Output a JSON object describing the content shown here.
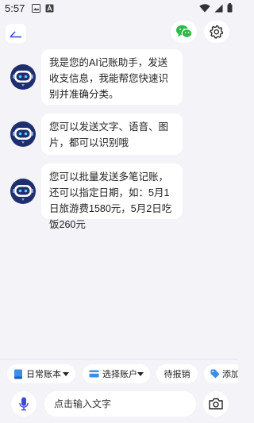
{
  "status": {
    "time": "5:57"
  },
  "messages": [
    {
      "text": "我是您的AI记账助手，发送收支信息，我能帮您快速识别并准确分类。"
    },
    {
      "text": "您可以发送文字、语音、图片，都可以识别哦"
    },
    {
      "text": "您可以批量发送多笔记账，还可以指定日期，如：5月1日旅游费1580元，5月2日吃饭260元"
    }
  ],
  "chips": {
    "ledger": "日常账本",
    "account": "选择账户",
    "reimburse": "待报销",
    "tag": "添加"
  },
  "input": {
    "placeholder": "点击输入文字"
  },
  "colors": {
    "background": "#f3f3f8",
    "wechat_green": "#2fb84a",
    "ledger_blue": "#3a8ee6",
    "mic_blue": "#3f4ad8",
    "avatar_navy": "#1f2f6e"
  }
}
